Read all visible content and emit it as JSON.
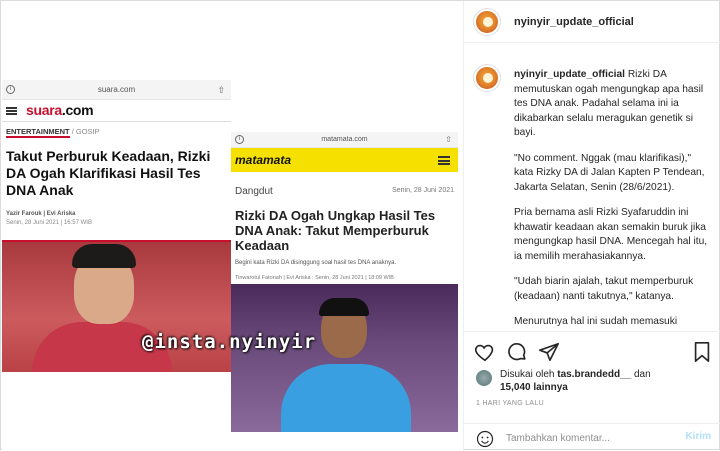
{
  "post": {
    "username": "nyinyir_update_official",
    "caption_username": "nyinyir_update_official",
    "caption_paragraphs": [
      "Rizki DA memutuskan ogah mengungkap apa hasil tes DNA anak. Padahal selama ini ia dikabarkan selalu meragukan genetik si bayi.",
      "\"No comment. Nggak (mau klarifikasi),\" kata Rizky DA di Jalan Kapten P Tendean, Jakarta Selatan, Senin (28/6/2021).",
      "Pria bernama asli Rizki Syafaruddin ini khawatir keadaan akan semakin buruk jika mengungkap hasil DNA. Mencegah hal itu, ia memilih merahasiakannya.",
      "\"Udah biarin ajalah, takut memperburuk (keadaan) nanti takutnya,\" katanya.",
      "Menurutnya hal ini sudah memasuki"
    ],
    "liked_by_prefix": "Disukai oleh",
    "liked_by_user": "tas.brandedd__",
    "liked_by_and": "dan",
    "likes_count": "15,040",
    "likes_suffix": "lainnya",
    "time_ago": "1 HARI YANG LALU",
    "comment_placeholder": "Tambahkan komentar...",
    "post_button": "Kirim"
  },
  "image": {
    "watermark": "@insta.nyinyir",
    "card1": {
      "url": "suara.com",
      "logo_red": "suara",
      "logo_dark": ".com",
      "category": "ENTERTAINMENT",
      "subcategory": "/ GOSIP",
      "title": "Takut Perburuk Keadaan, Rizki DA Ogah Klarifikasi Hasil Tes DNA Anak",
      "author": "Yazir Farouk | Evi Ariska",
      "date": "Senin, 28 Juni 2021 | 16:57 WIB"
    },
    "card2": {
      "url": "matamata.com",
      "logo": "matamata",
      "category": "Dangdut",
      "date": "Senin, 28 Juni 2021",
      "title": "Rizki DA Ogah Ungkap Hasil Tes DNA Anak: Takut Memperburuk Keadaan",
      "lead": "Begini kata Rizki DA disinggung soal hasil tes DNA anaknya.",
      "author": "Tinwarotul Fatonah | Evi Ariska : Senin, 28 Juni 2021 | 18:09 WIB"
    }
  },
  "icons": {
    "like": "heart-icon",
    "comment": "comment-icon",
    "share": "paper-plane-icon",
    "save": "bookmark-icon",
    "emoji": "smiley-icon"
  },
  "colors": {
    "suara_red": "#c8102e",
    "matamata_yellow": "#f5e000",
    "post_button_disabled": "#b2dffc"
  }
}
